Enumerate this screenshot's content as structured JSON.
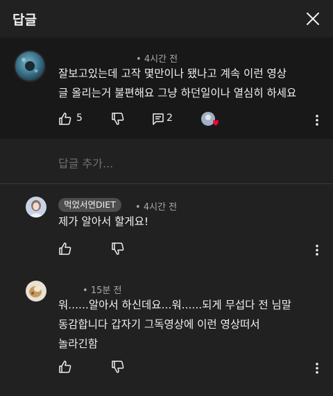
{
  "header": {
    "title": "답글",
    "close_icon": "close-icon"
  },
  "main_comment": {
    "author": "",
    "time": "4시간 전",
    "lines": [
      "잘보고있는데 고작 몇만이나 됐나고 계속 이런 영상",
      "글 올리는거 불편해요 그냥 하던일이나 열심히 하세요"
    ],
    "likes": "5",
    "replies": "2",
    "heart_color": "#ff0033"
  },
  "add_reply": {
    "placeholder": "답글 추가..."
  },
  "replies": [
    {
      "author": "먹었서연DIET",
      "time": "4시간 전",
      "lines": [
        "제가 알아서 할게요!"
      ]
    },
    {
      "author": "",
      "time": "15분 전",
      "lines": [
        "워......알아서 하신데요...워......되게 무섭다 전 님말",
        "동감합니다 갑자기 그독영상에 이런 영상떠서",
        "놀라긴함"
      ]
    }
  ],
  "colors": {
    "background": "#212121",
    "highlight": "#181818",
    "muted": "#aaaaaa",
    "chip": "#4d4d4d"
  }
}
